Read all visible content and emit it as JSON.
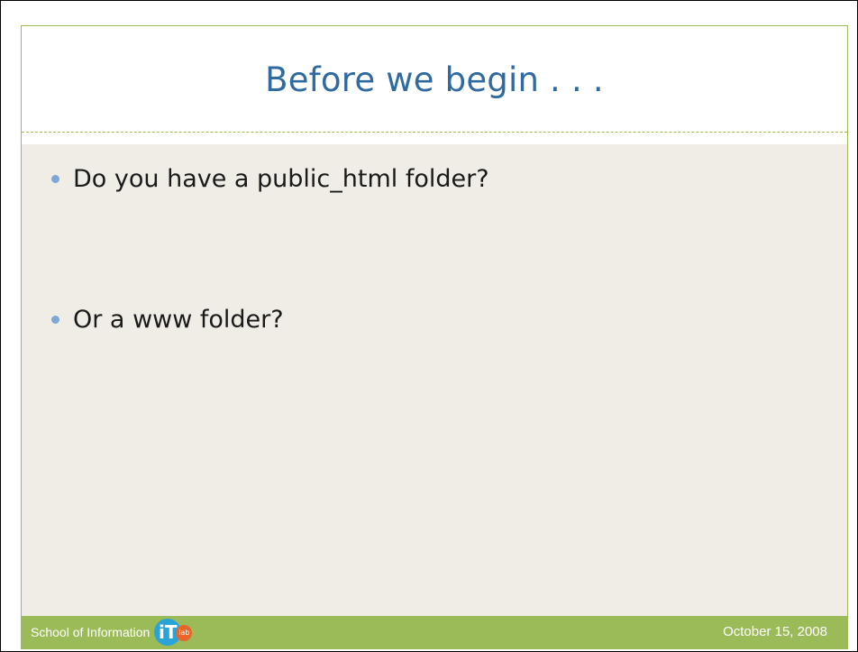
{
  "slide": {
    "title": "Before we begin . . .",
    "bullets": [
      "Do you have a public_html folder?",
      "Or a www folder?"
    ]
  },
  "footer": {
    "school": "School of Information",
    "logo_letters": "iT",
    "logo_badge": "lab",
    "date": "October 15, 2008"
  },
  "colors": {
    "title": "#2f6aa0",
    "accent_green": "#9bbb59",
    "content_bg": "#efede6",
    "bullet_dot": "#7ba7d9",
    "logo_blue": "#2aa3d8",
    "logo_orange": "#e8662a"
  }
}
